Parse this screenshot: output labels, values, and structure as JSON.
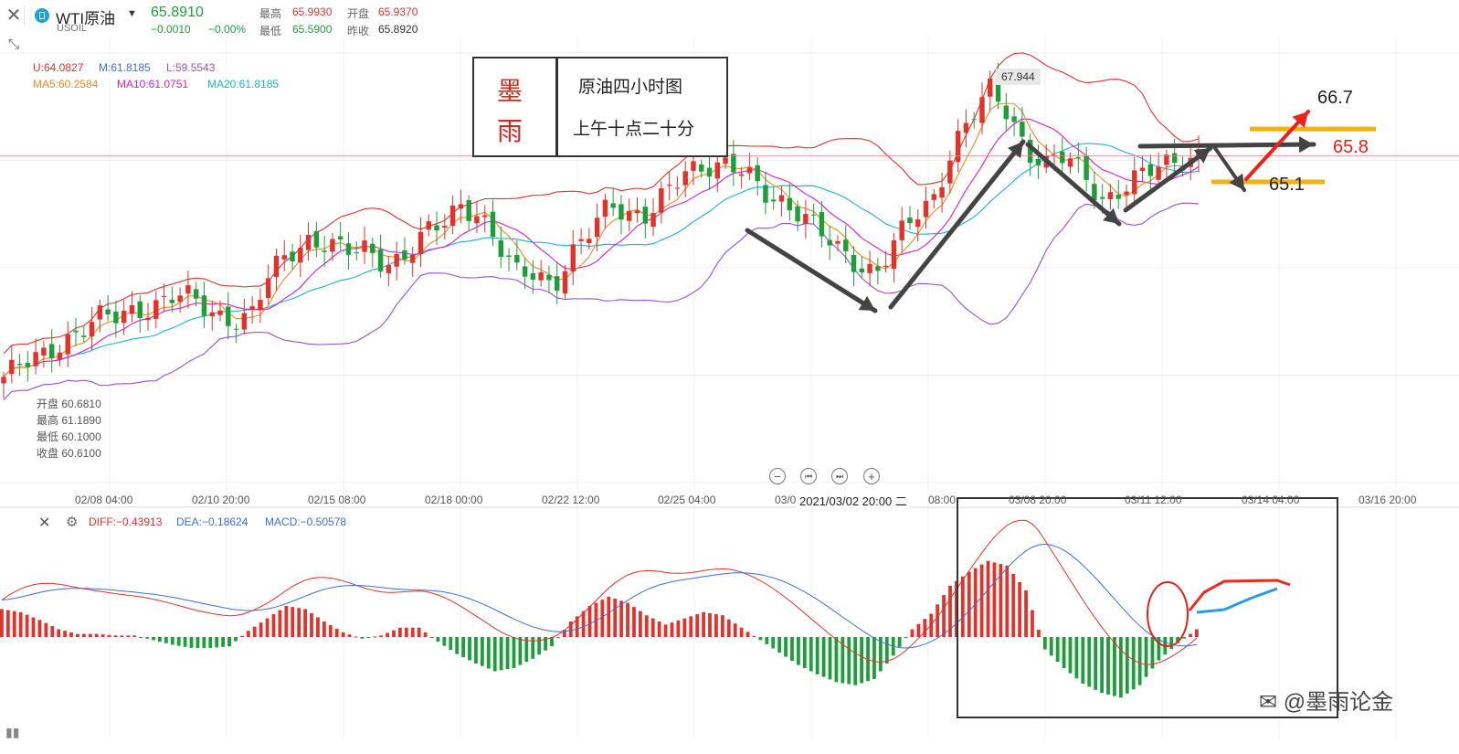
{
  "header": {
    "symbol": "WTI原油",
    "code": "USOIL",
    "price": "65.8910",
    "change": "−0.0010",
    "change_pct": "−0.00%",
    "quotes": [
      {
        "label": "最高",
        "value": "65.9930",
        "color": "#e0332b"
      },
      {
        "label": "开盘",
        "value": "65.9370",
        "color": "#e0332b"
      },
      {
        "label": "最低",
        "value": "65.5900",
        "color": "#1e9e3a"
      },
      {
        "label": "昨收",
        "value": "65.8920",
        "color": "#333333"
      }
    ]
  },
  "indicators": {
    "boll": [
      {
        "text": "U:64.0827",
        "color": "#e0332b"
      },
      {
        "text": "M:61.8185",
        "color": "#3c6fd4"
      },
      {
        "text": "L:59.5543",
        "color": "#9b4ed6"
      }
    ],
    "ma": [
      {
        "text": "MA5:60.2584",
        "color": "#ef8a1f"
      },
      {
        "text": "MA10:61.0751",
        "color": "#d81ecb"
      },
      {
        "text": "MA20:61.8185",
        "color": "#1ab3d4"
      }
    ]
  },
  "note_box": {
    "char1": "墨",
    "char2": "雨",
    "line1": "原油四小时图",
    "line2": "上午十点二十分"
  },
  "ohlc_panel": [
    {
      "label": "开盘",
      "value": "60.6810"
    },
    {
      "label": "最高",
      "value": "61.1890"
    },
    {
      "label": "最低",
      "value": "60.1000"
    },
    {
      "label": "收盘",
      "value": "60.6100"
    }
  ],
  "high_label": "67.944",
  "levels": {
    "upper": "66.7",
    "mid": "65.8",
    "lower": "65.1"
  },
  "x_ticks": [
    "02/08 04:00",
    "02/10 20:00",
    "02/15 08:00",
    "02/18 00:00",
    "02/22 12:00",
    "02/25 04:00",
    "03/0",
    "03/08 20:00",
    "03/11 12:00",
    "03/14 04:00",
    "03/16 20:00"
  ],
  "hover_time": "2021/03/02 20:00 二",
  "hover_time_tail": "08:00",
  "zoom_icons": [
    "zoom-out-icon",
    "step-back-icon",
    "step-forward-icon",
    "zoom-in-icon"
  ],
  "macd_header": [
    {
      "text": "DIFF:−0.43913",
      "color": "#e0332b"
    },
    {
      "text": "DEA:−0.18624",
      "color": "#3c6fd4"
    },
    {
      "text": "MACD:−0.50578",
      "color": "#3c6fd4"
    }
  ],
  "watermark": "@墨雨论金",
  "colors": {
    "up": "#e0332b",
    "down": "#1e9e3a",
    "grid": "#eeeeee"
  },
  "chart_data": [
    {
      "type": "candlestick",
      "x_labels": [
        "02/08 04:00",
        "02/10 20:00",
        "02/15 08:00",
        "02/18 00:00",
        "02/22 12:00",
        "02/25 04:00",
        "03/08 20:00",
        "03/11 12:00",
        "03/14 04:00",
        "03/16 20:00"
      ],
      "close_path": [
        59.2,
        59.5,
        59.8,
        60.3,
        60.6,
        60.9,
        61.0,
        61.3,
        61.4,
        61.6,
        61.5,
        61.2,
        61.0,
        60.9,
        62.2,
        63.0,
        63.4,
        63.2,
        62.9,
        63.1,
        62.8,
        62.7,
        63.3,
        63.8,
        64.5,
        64.2,
        63.1,
        62.3,
        62.5,
        62.0,
        62.8,
        63.6,
        64.6,
        64.2,
        64.0,
        64.7,
        65.5,
        65.7,
        65.6,
        65.3,
        64.8,
        64.6,
        64.2,
        63.5,
        63.0,
        62.7,
        62.4,
        63.2,
        64.0,
        64.6,
        66.2,
        67.0,
        67.8,
        67.2,
        66.1,
        65.6,
        65.8,
        65.3,
        64.6,
        64.9,
        65.2,
        65.6,
        65.9,
        65.9
      ],
      "levels": [
        66.7,
        65.8,
        65.1
      ],
      "high_marker": 67.944,
      "current": 65.891
    },
    {
      "type": "bar",
      "title": "MACD",
      "series_names": [
        "DIFF",
        "DEA",
        "MACD"
      ],
      "histogram": [
        0.18,
        0.16,
        0.11,
        0.05,
        0.02,
        0.02,
        0.01,
        0.01,
        -0.02,
        -0.05,
        -0.07,
        -0.07,
        -0.06,
        0.04,
        0.12,
        0.2,
        0.18,
        0.1,
        0.03,
        -0.01,
        0.01,
        0.06,
        0.06,
        -0.03,
        -0.11,
        -0.17,
        -0.22,
        -0.2,
        -0.14,
        -0.06,
        0.1,
        0.2,
        0.26,
        0.22,
        0.14,
        0.08,
        0.12,
        0.16,
        0.14,
        0.06,
        -0.02,
        -0.1,
        -0.18,
        -0.24,
        -0.29,
        -0.31,
        -0.27,
        -0.12,
        0.05,
        0.15,
        0.33,
        0.42,
        0.49,
        0.46,
        0.3,
        -0.08,
        -0.2,
        -0.3,
        -0.36,
        -0.39,
        -0.31,
        -0.15,
        -0.04,
        0.05
      ]
    }
  ]
}
